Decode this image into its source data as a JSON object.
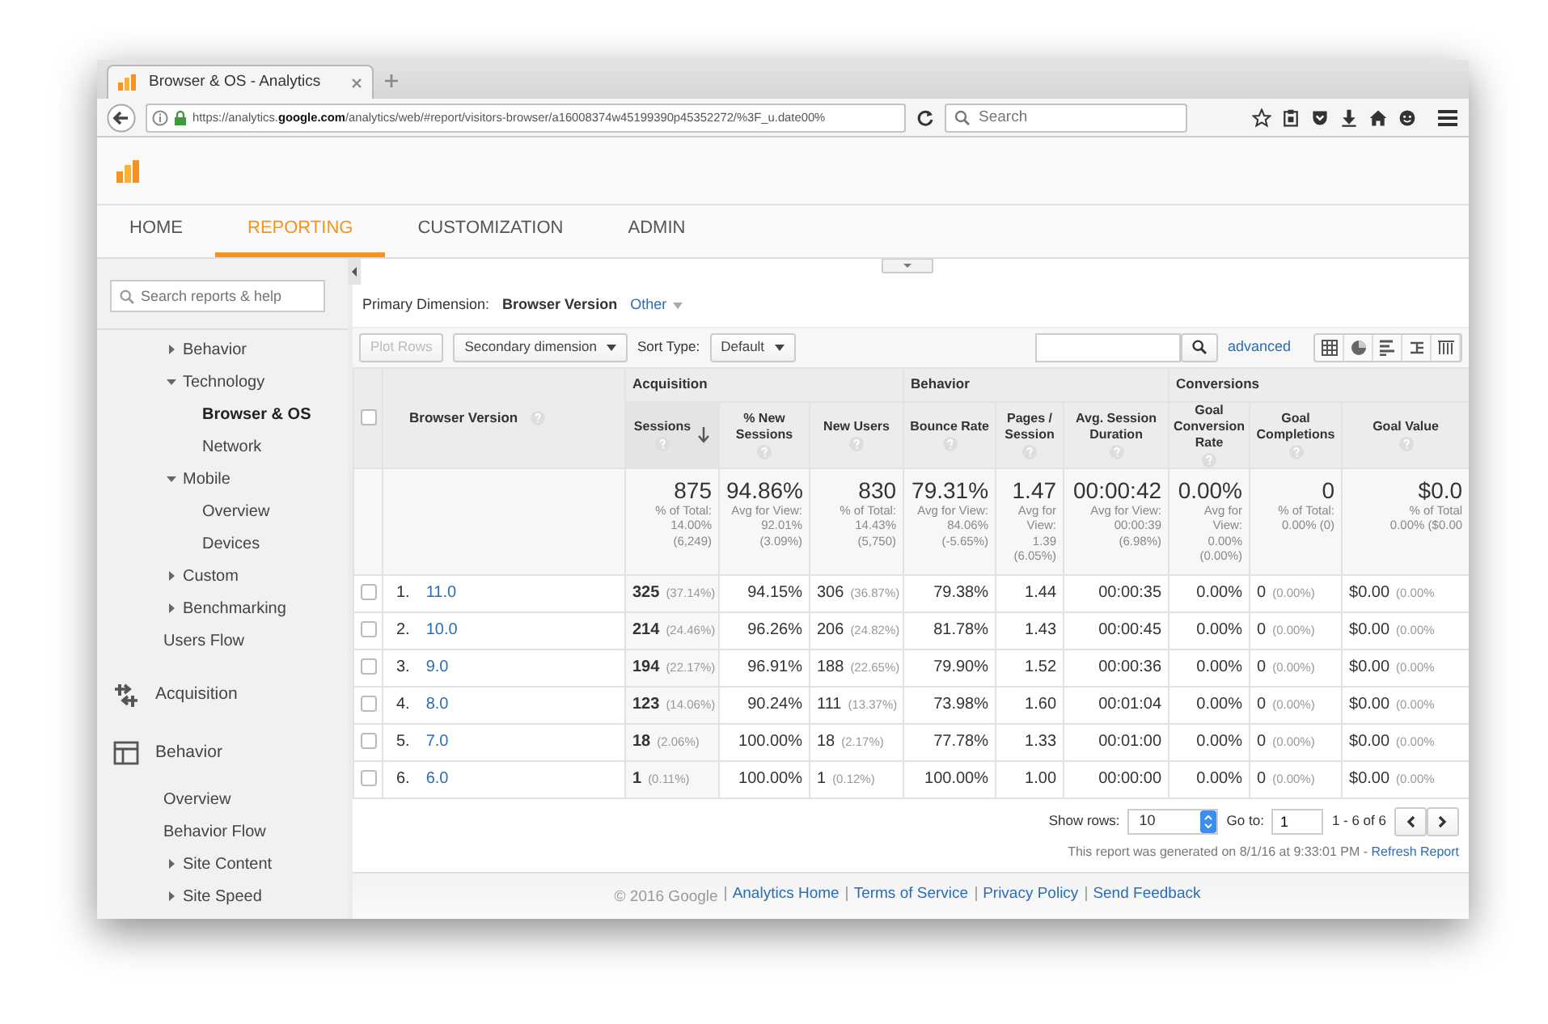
{
  "browser": {
    "tab_title": "Browser & OS - Analytics",
    "url": "https://analytics.**google.com**/analytics/web/#report/visitors-browser/a16008374w45199390p45352272/%3F_u.date00%",
    "search_placeholder": "Search"
  },
  "nav": [
    {
      "label": "HOME",
      "selected": false
    },
    {
      "label": "REPORTING",
      "selected": true
    },
    {
      "label": "CUSTOMIZATION",
      "selected": false
    },
    {
      "label": "ADMIN",
      "selected": false
    }
  ],
  "sidebar": {
    "search_placeholder": "Search reports & help",
    "items": [
      {
        "kind": "group",
        "label": "Behavior",
        "expanded": false
      },
      {
        "kind": "group",
        "label": "Technology",
        "expanded": true,
        "children": [
          {
            "kind": "link",
            "label": "Browser & OS",
            "selected": true
          },
          {
            "kind": "link",
            "label": "Network",
            "selected": false
          }
        ]
      },
      {
        "kind": "group",
        "label": "Mobile",
        "expanded": true,
        "children": [
          {
            "kind": "link",
            "label": "Overview",
            "selected": false
          },
          {
            "kind": "link",
            "label": "Devices",
            "selected": false
          }
        ]
      },
      {
        "kind": "group",
        "label": "Custom",
        "expanded": false
      },
      {
        "kind": "group",
        "label": "Benchmarking",
        "expanded": false
      },
      {
        "kind": "link",
        "label": "Users Flow",
        "selected": false
      }
    ],
    "sections": [
      {
        "label": "Acquisition"
      },
      {
        "label": "Behavior",
        "children": [
          {
            "kind": "link",
            "label": "Overview",
            "selected": false
          },
          {
            "kind": "link",
            "label": "Behavior Flow",
            "selected": false
          },
          {
            "kind": "group",
            "label": "Site Content",
            "expanded": false
          },
          {
            "kind": "group",
            "label": "Site Speed",
            "expanded": false
          }
        ]
      }
    ]
  },
  "report": {
    "primary_label": "Primary Dimension:",
    "primary_value": "Browser Version",
    "other": "Other",
    "plot_rows": "Plot Rows",
    "secondary": "Secondary dimension",
    "sort_label": "Sort Type:",
    "sort_value": "Default",
    "advanced": "advanced",
    "table": {
      "dimension": "Browser Version",
      "select_all_checked": false,
      "groups": [
        {
          "label": "Acquisition",
          "columns": [
            {
              "label": "Sessions",
              "sorted": true
            },
            {
              "label": "% New Sessions",
              "sorted": false
            },
            {
              "label": "New Users",
              "sorted": false
            }
          ]
        },
        {
          "label": "Behavior",
          "columns": [
            {
              "label": "Bounce Rate",
              "sorted": false
            },
            {
              "label": "Pages / Session",
              "sorted": false
            },
            {
              "label": "Avg. Session Duration",
              "sorted": false
            }
          ]
        },
        {
          "label": "Conversions",
          "columns": [
            {
              "label": "Goal Conversion Rate",
              "sorted": false
            },
            {
              "label": "Goal Completions",
              "sorted": false
            },
            {
              "label": "Goal Value",
              "sorted": false
            }
          ]
        }
      ],
      "totals": [
        {
          "value": "875",
          "lines": [
            "% of Total:",
            "14.00%",
            "(6,249)"
          ]
        },
        {
          "value": "94.86%",
          "lines": [
            "Avg for View:",
            "92.01%",
            "(3.09%)"
          ]
        },
        {
          "value": "830",
          "lines": [
            "% of Total:",
            "14.43%",
            "(5,750)"
          ]
        },
        {
          "value": "79.31%",
          "lines": [
            "Avg for View:",
            "84.06%",
            "(-5.65%)"
          ]
        },
        {
          "value": "1.47",
          "lines": [
            "Avg for",
            "View:",
            "1.39",
            "(6.05%)"
          ]
        },
        {
          "value": "00:00:42",
          "lines": [
            "Avg for View:",
            "00:00:39",
            "(6.98%)"
          ]
        },
        {
          "value": "0.00%",
          "lines": [
            "Avg for",
            "View:",
            "0.00%",
            "(0.00%)"
          ]
        },
        {
          "value": "0",
          "lines": [
            "% of Total:",
            "0.00% (0)"
          ]
        },
        {
          "value": "$0.0",
          "lines": [
            "% of Total",
            "0.00% ($0.00"
          ]
        }
      ],
      "rows": [
        {
          "index": "1.",
          "version": "11.0",
          "checked": false,
          "cells": [
            {
              "value": "325",
              "share": "(37.14%)"
            },
            {
              "value": "94.15%"
            },
            {
              "value": "306",
              "share": "(36.87%)"
            },
            {
              "value": "79.38%"
            },
            {
              "value": "1.44"
            },
            {
              "value": "00:00:35"
            },
            {
              "value": "0.00%"
            },
            {
              "value": "0",
              "share": "(0.00%)"
            },
            {
              "value": "$0.00",
              "share": "(0.00%"
            }
          ]
        },
        {
          "index": "2.",
          "version": "10.0",
          "checked": false,
          "cells": [
            {
              "value": "214",
              "share": "(24.46%)"
            },
            {
              "value": "96.26%"
            },
            {
              "value": "206",
              "share": "(24.82%)"
            },
            {
              "value": "81.78%"
            },
            {
              "value": "1.43"
            },
            {
              "value": "00:00:45"
            },
            {
              "value": "0.00%"
            },
            {
              "value": "0",
              "share": "(0.00%)"
            },
            {
              "value": "$0.00",
              "share": "(0.00%"
            }
          ]
        },
        {
          "index": "3.",
          "version": "9.0",
          "checked": false,
          "cells": [
            {
              "value": "194",
              "share": "(22.17%)"
            },
            {
              "value": "96.91%"
            },
            {
              "value": "188",
              "share": "(22.65%)"
            },
            {
              "value": "79.90%"
            },
            {
              "value": "1.52"
            },
            {
              "value": "00:00:36"
            },
            {
              "value": "0.00%"
            },
            {
              "value": "0",
              "share": "(0.00%)"
            },
            {
              "value": "$0.00",
              "share": "(0.00%"
            }
          ]
        },
        {
          "index": "4.",
          "version": "8.0",
          "checked": false,
          "cells": [
            {
              "value": "123",
              "share": "(14.06%)"
            },
            {
              "value": "90.24%"
            },
            {
              "value": "111",
              "share": "(13.37%)"
            },
            {
              "value": "73.98%"
            },
            {
              "value": "1.60"
            },
            {
              "value": "00:01:04"
            },
            {
              "value": "0.00%"
            },
            {
              "value": "0",
              "share": "(0.00%)"
            },
            {
              "value": "$0.00",
              "share": "(0.00%"
            }
          ]
        },
        {
          "index": "5.",
          "version": "7.0",
          "checked": false,
          "cells": [
            {
              "value": "18",
              "share": "(2.06%)"
            },
            {
              "value": "100.00%"
            },
            {
              "value": "18",
              "share": "(2.17%)"
            },
            {
              "value": "77.78%"
            },
            {
              "value": "1.33"
            },
            {
              "value": "00:01:00"
            },
            {
              "value": "0.00%"
            },
            {
              "value": "0",
              "share": "(0.00%)"
            },
            {
              "value": "$0.00",
              "share": "(0.00%"
            }
          ]
        },
        {
          "index": "6.",
          "version": "6.0",
          "checked": false,
          "cells": [
            {
              "value": "1",
              "share": "(0.11%)"
            },
            {
              "value": "100.00%"
            },
            {
              "value": "1",
              "share": "(0.12%)"
            },
            {
              "value": "100.00%"
            },
            {
              "value": "1.00"
            },
            {
              "value": "00:00:00"
            },
            {
              "value": "0.00%"
            },
            {
              "value": "0",
              "share": "(0.00%)"
            },
            {
              "value": "$0.00",
              "share": "(0.00%"
            }
          ]
        }
      ]
    },
    "pager": {
      "show_rows_label": "Show rows:",
      "show_rows_value": "10",
      "goto_label": "Go to:",
      "goto_value": "1",
      "range": "1 - 6 of 6"
    },
    "generated": "This report was generated on 8/1/16 at 9:33:01 PM -",
    "refresh": "Refresh Report"
  },
  "footer": {
    "copyright": "© 2016 Google",
    "links": [
      "Analytics Home",
      "Terms of Service",
      "Privacy Policy",
      "Send Feedback"
    ]
  }
}
